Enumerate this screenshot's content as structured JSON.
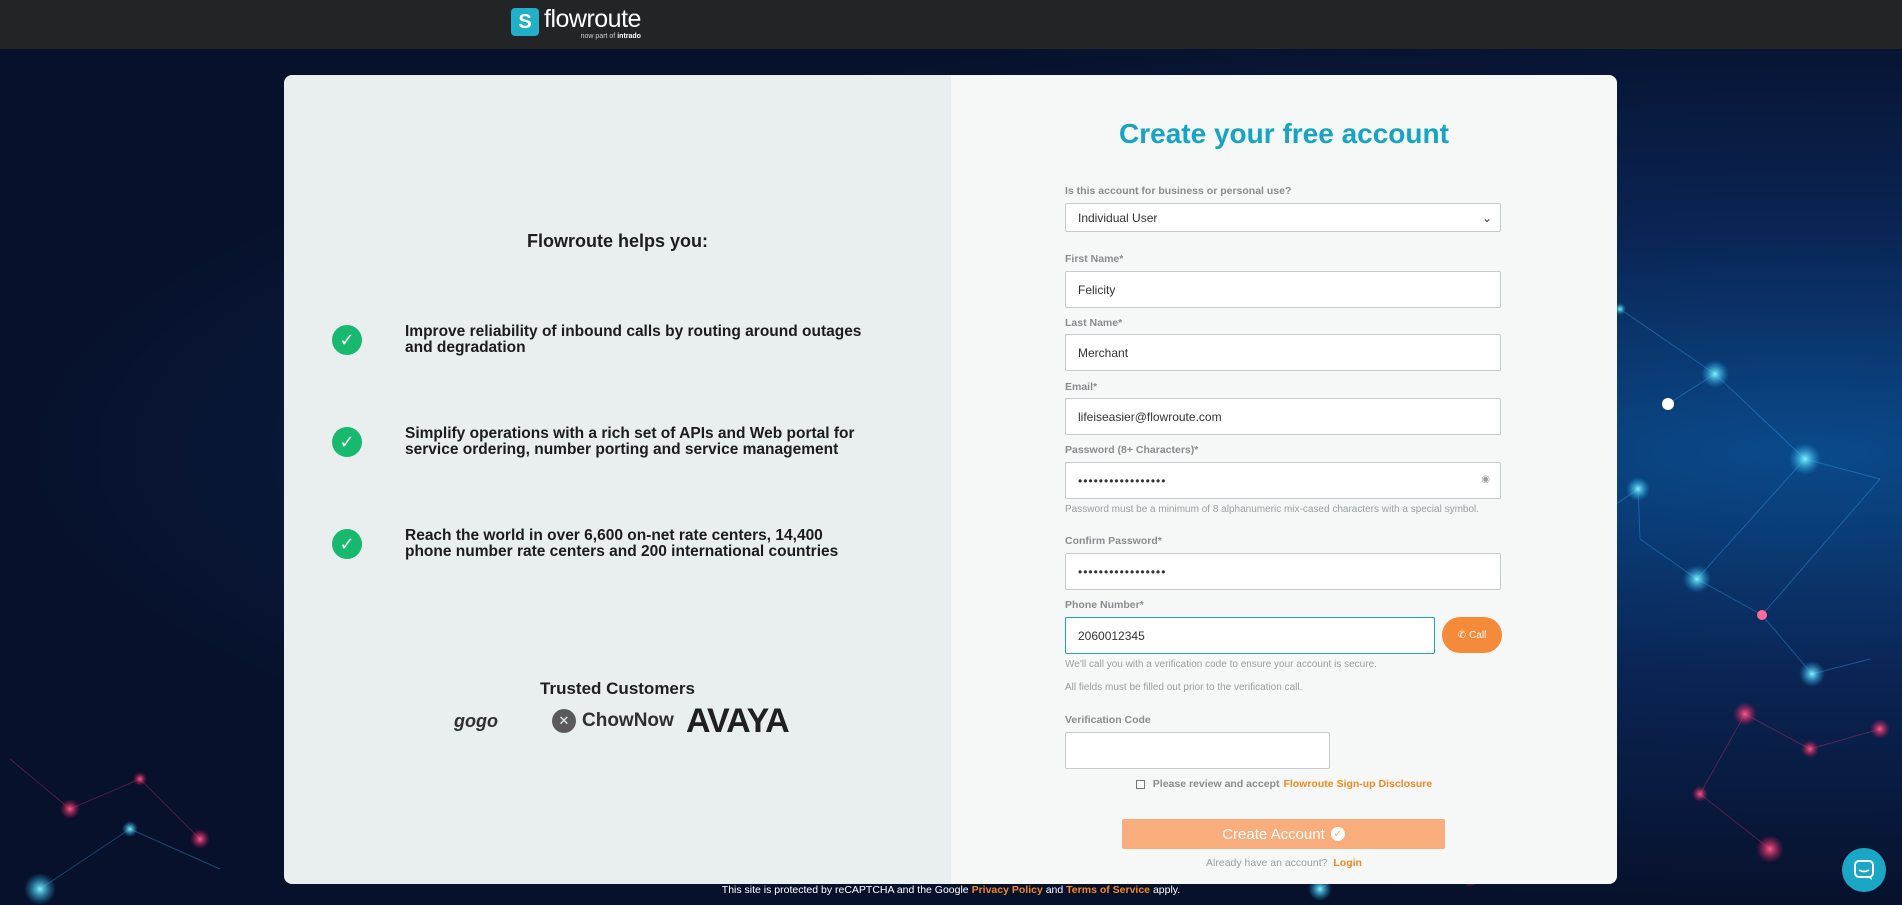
{
  "header": {
    "logo_name": "flowroute",
    "logo_tag_prefix": "now part of",
    "logo_tag_brand": "intrado"
  },
  "left_panel": {
    "title": "Flowroute helps you:",
    "benefits": [
      {
        "line1": "Improve reliability of inbound calls by routing around outages",
        "line2": "and degradation"
      },
      {
        "line1": "Simplify operations with a rich set of APIs and Web portal for",
        "line2": "service ordering, number porting and service management"
      },
      {
        "line1": "Reach the world in over 6,600 on-net rate centers, 14,400",
        "line2": "phone number rate centers and 200 international countries"
      }
    ],
    "trusted_title": "Trusted Customers",
    "customers": [
      "gogo",
      "ChowNow",
      "AVAYA"
    ]
  },
  "form": {
    "title": "Create your free account",
    "account_type_label": "Is this account for business or personal use?",
    "account_type_value": "Individual User",
    "first_name_label": "First Name*",
    "first_name_value": "Felicity",
    "last_name_label": "Last Name*",
    "last_name_value": "Merchant",
    "email_label": "Email*",
    "email_value": "lifeiseasier@flowroute.com",
    "password_label": "Password (8+ Characters)*",
    "password_value": "•••••••••••••••••",
    "password_hint": "Password must be a minimum of 8 alphanumeric mix-cased characters with a special symbol.",
    "confirm_password_label": "Confirm Password*",
    "confirm_password_value": "•••••••••••••••••",
    "phone_label": "Phone Number*",
    "phone_value": "2060012345",
    "call_button": "Call",
    "phone_hint_1": "We'll call you with a verification code to ensure your account is secure.",
    "phone_hint_2": "All fields must be filled out prior to the verification call.",
    "verification_label": "Verification Code",
    "verification_value": "",
    "disclosure_text": "Please review and accept",
    "disclosure_link": "Flowroute Sign-up Disclosure",
    "create_button": "Create Account",
    "already_text": "Already have an account?",
    "login_link": "Login"
  },
  "footer": {
    "recaptcha_prefix": "This site is protected by reCAPTCHA and the Google",
    "privacy_link": "Privacy Policy",
    "and": "and",
    "terms_link": "Terms of Service",
    "suffix": "apply."
  },
  "colors": {
    "brand_teal": "#16a4c3",
    "accent_orange": "#f58a3a",
    "check_green": "#17b96e"
  }
}
